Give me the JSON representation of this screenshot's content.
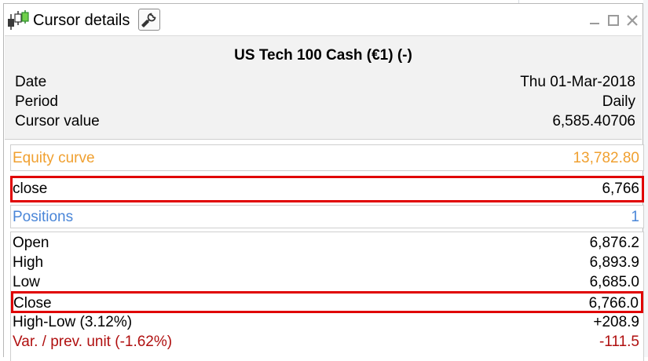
{
  "window": {
    "title": "Cursor details"
  },
  "header": {
    "instrument": "US Tech 100 Cash (€1) (-)",
    "rows": [
      {
        "label": "Date",
        "value": "Thu 01-Mar-2018"
      },
      {
        "label": "Period",
        "value": "Daily"
      },
      {
        "label": "Cursor value",
        "value": "6,585.40706"
      }
    ]
  },
  "equity": {
    "label": "Equity curve",
    "value": "13,782.80",
    "color": "#f0a030"
  },
  "close_indicator": {
    "label": "close",
    "value": "6,766"
  },
  "positions": {
    "label": "Positions",
    "value": "1",
    "color": "#4a86d8"
  },
  "ohlc": {
    "open": {
      "label": "Open",
      "value": "6,876.2"
    },
    "high": {
      "label": "High",
      "value": "6,893.9"
    },
    "low": {
      "label": "Low",
      "value": "6,685.0"
    },
    "close": {
      "label": "Close",
      "value": "6,766.0"
    },
    "high_low": {
      "label": "High-Low (3.12%)",
      "value": "+208.9"
    },
    "variation": {
      "label": "Var. / prev. unit (-1.62%)",
      "value": "-111.5",
      "color": "#b01010"
    }
  },
  "icons": {
    "app": "candlestick-chart-icon",
    "settings": "wrench-icon",
    "minimize": "minimize-icon",
    "maximize": "maximize-icon",
    "close": "close-icon"
  },
  "highlight_color": "#e00000"
}
